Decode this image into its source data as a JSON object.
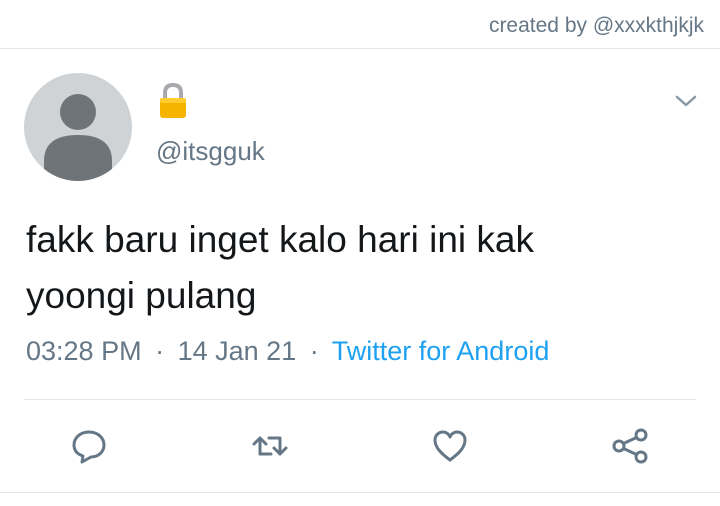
{
  "header": {
    "credit": "created by @xxxkthjkjk"
  },
  "tweet": {
    "lock_icon": "lock-icon",
    "handle": "@itsgguk",
    "text_line1": "fakk baru inget kalo hari ini kak",
    "text_line2": "yoongi pulang",
    "time": "03:28 PM",
    "date": "14 Jan 21",
    "separator": "·",
    "source": "Twitter for Android"
  },
  "actions": [
    "reply-icon",
    "retweet-icon",
    "like-icon",
    "share-icon"
  ],
  "colors": {
    "accent": "#1da1f2",
    "muted_text": "#657786",
    "text": "#14171a",
    "divider": "#e1e8ed",
    "avatar_bg": "#cfd3d6",
    "avatar_fg": "#6e7478",
    "lock": "#f5b400"
  }
}
